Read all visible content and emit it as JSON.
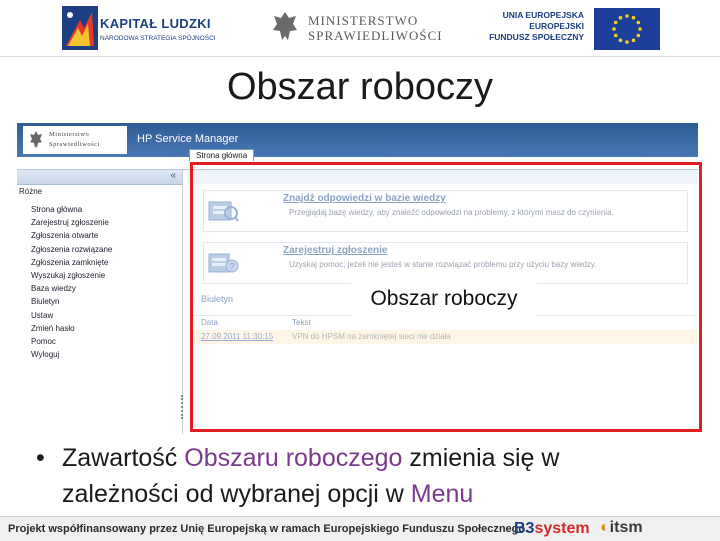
{
  "banner": {
    "kapital_title": "KAPITAŁ LUDZKI",
    "kapital_subtitle": "NARODOWA STRATEGIA SPÓJNOŚCI",
    "ministry_line1": "MINISTERSTWO",
    "ministry_line2": "SPRAWIEDLIWOŚCI",
    "eu_line1": "UNIA EUROPEJSKA",
    "eu_line2": "EUROPEJSKI",
    "eu_line3": "FUNDUSZ SPOŁECZNY"
  },
  "slide": {
    "title": "Obszar roboczy",
    "callout": "Obszar roboczy",
    "bullet_symbol": "•",
    "bullet_part1": "Zawartość ",
    "bullet_highlight1": "Obszaru roboczego",
    "bullet_part2": " zmienia się w zależności od wybranej opcji w ",
    "bullet_highlight2": "Menu"
  },
  "app": {
    "badge_line1": "Ministerstwo",
    "badge_line2": "Sprawiedliwości",
    "name": "HP Service Manager",
    "tab_home": "Strona główna",
    "collapse_symbol": "«",
    "menu_title": "Różne",
    "menu_items": [
      "Strona główna",
      "Zarejestruj zgłoszenie",
      "Zgłoszenia otwarte",
      "Zgłoszenia rozwiązane",
      "Zgłoszenia zamknięte",
      "Wyszukaj zgłoszenie",
      "Baza wiedzy",
      "Biuletyn",
      "Ustaw",
      "Zmień hasło",
      "Pomoc",
      "Wyloguj"
    ],
    "cards": [
      {
        "title": "Znajdź odpowiedzi w bazie wiedzy",
        "description": "Przeglądaj bazę wiedzy, aby znaleźć odpowiedzi na problemy, z którymi masz do czynienia."
      },
      {
        "title": "Zarejestruj zgłoszenie",
        "description": "Uzyskaj pomoc, jeżeli nie jesteś w stanie rozwiązać problemu przy użyciu bazy wiedzy."
      }
    ],
    "bulletin_label": "Biuletyn",
    "table_headers": [
      "Data",
      "Tekst"
    ],
    "table_row": {
      "date": "27.09.2011 11:30:15",
      "text": "VPN do HPSM na zamkniętej sieci nie działa"
    }
  },
  "footer": {
    "text": "Projekt współfinansowany przez Unię Europejską w ramach Europejskiego Funduszu Społecznego.",
    "b3_part1": "B3",
    "b3_part2": "system",
    "itsm_mark": "◐",
    "itsm_text": "itsm"
  },
  "colors": {
    "frame": "#e02020",
    "highlight": "#7a3b8f",
    "app_header": "#2f5c96"
  }
}
